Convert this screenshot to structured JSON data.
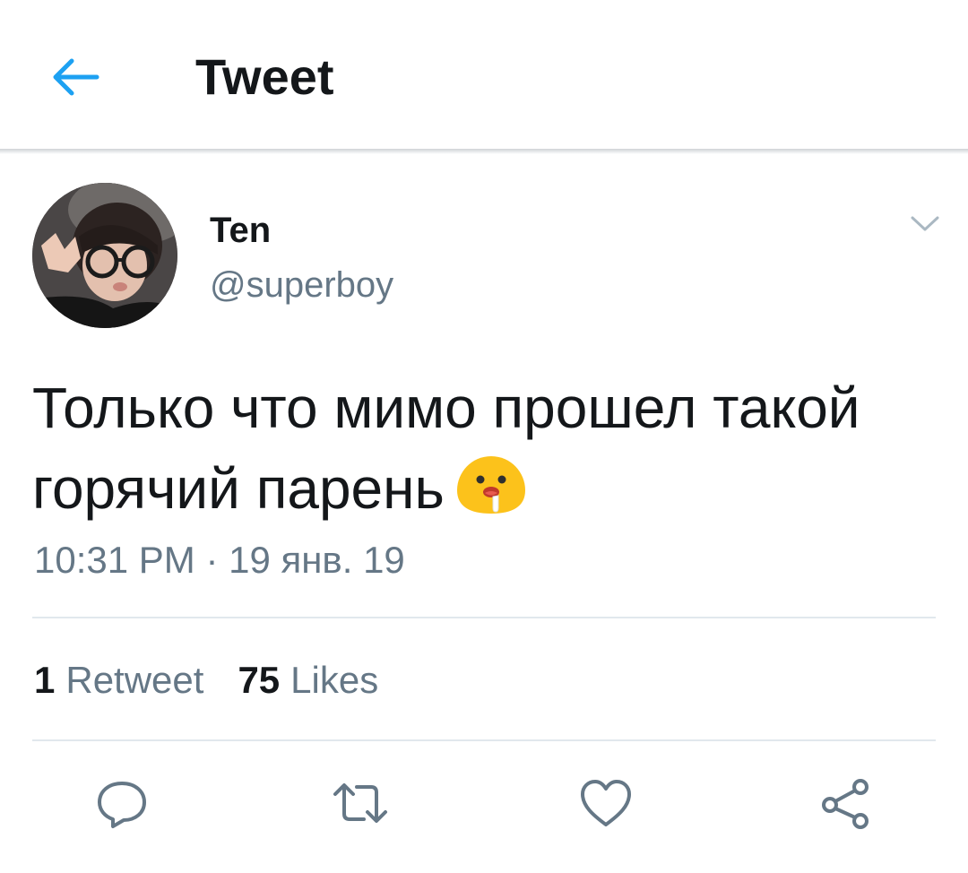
{
  "header": {
    "title": "Tweet",
    "back_icon": "back-arrow-icon"
  },
  "tweet": {
    "author_name": "Ten",
    "author_handle": "@superboy",
    "text": "Только что мимо прошел такой горячий парень",
    "emoji": "drooling-face-emoji",
    "timestamp": "10:31 PM · 19 янв. 19"
  },
  "stats": {
    "retweets_count": "1",
    "retweets_label": "Retweet",
    "likes_count": "75",
    "likes_label": "Likes"
  },
  "actions": [
    "reply-icon",
    "retweet-icon",
    "like-icon",
    "share-icon"
  ],
  "colors": {
    "accent": "#1da1f2",
    "text_primary": "#14171a",
    "text_secondary": "#657786",
    "divider": "#e1e8ed"
  }
}
